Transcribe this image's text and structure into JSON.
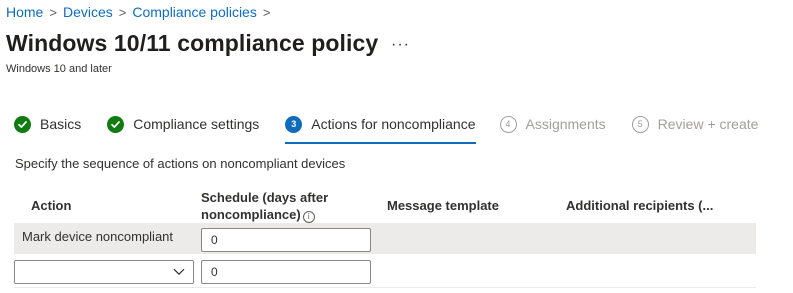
{
  "breadcrumb": {
    "items": [
      "Home",
      "Devices",
      "Compliance policies"
    ]
  },
  "header": {
    "title": "Windows 10/11 compliance policy",
    "more": "···",
    "subtitle": "Windows 10 and later"
  },
  "wizard": {
    "steps": [
      {
        "label": "Basics",
        "state": "done"
      },
      {
        "label": "Compliance settings",
        "state": "done"
      },
      {
        "label": "Actions for noncompliance",
        "state": "current",
        "number": "3"
      },
      {
        "label": "Assignments",
        "state": "pending",
        "number": "4"
      },
      {
        "label": "Review + create",
        "state": "pending",
        "number": "5"
      }
    ]
  },
  "section": {
    "description": "Specify the sequence of actions on noncompliant devices"
  },
  "table": {
    "headers": {
      "action": "Action",
      "schedule": "Schedule (days after noncompliance)",
      "message": "Message template",
      "recipients": "Additional recipients (..."
    },
    "rows": [
      {
        "action": "Mark device noncompliant",
        "schedule": "0"
      },
      {
        "action": "",
        "schedule": "0"
      }
    ]
  },
  "colors": {
    "accent": "#0f6cbd",
    "success": "#107c10",
    "row_background": "#edebe9",
    "disabled_text": "#a19f9d"
  }
}
